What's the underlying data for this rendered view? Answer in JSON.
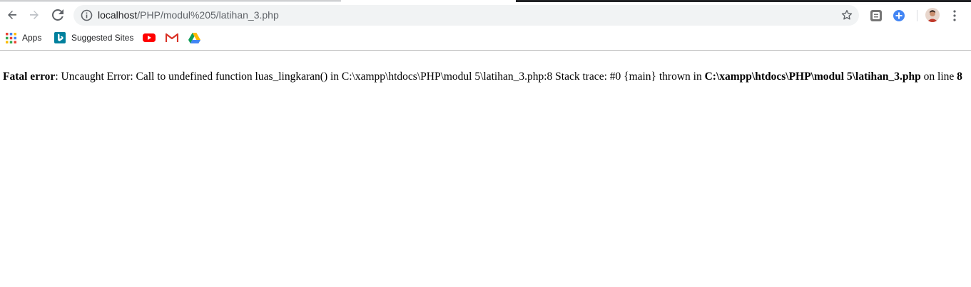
{
  "browser": {
    "url_host": "localhost",
    "url_path": "/PHP/modul%205/latihan_3.php",
    "icons": {
      "back": "arrow-left-icon",
      "forward": "arrow-right-icon",
      "reload": "reload-icon",
      "info": "info-icon",
      "star": "star-icon",
      "extension_1": "lens-icon",
      "extension_2": "plus-circle-icon",
      "menu": "kebab-menu-icon"
    }
  },
  "bookmarks": {
    "apps_label": "Apps",
    "suggested_label": "Suggested Sites"
  },
  "error": {
    "label": "Fatal error",
    "message": ": Uncaught Error: Call to undefined function luas_lingkaran() in C:\\xampp\\htdocs\\PHP\\modul 5\\latihan_3.php:8 Stack trace: #0 {main} thrown in ",
    "file": "C:\\xampp\\htdocs\\PHP\\modul 5\\latihan_3.php",
    "on_line_text": " on line ",
    "line": "8"
  },
  "colors": {
    "omnibox_bg": "#f1f3f4",
    "youtube_red": "#ff0000",
    "google_blue": "#4285f4",
    "bing_teal": "#00809d"
  }
}
